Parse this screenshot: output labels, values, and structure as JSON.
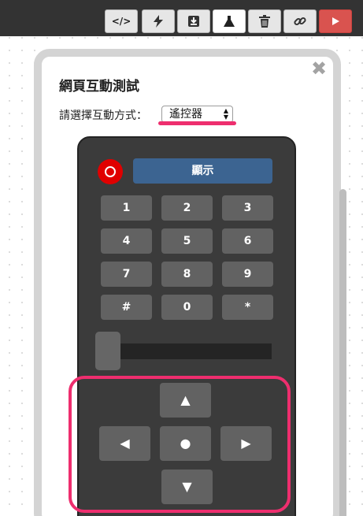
{
  "toolbar": {
    "buttons": [
      {
        "name": "code",
        "icon": "code-icon",
        "label": "</>"
      },
      {
        "name": "flash",
        "icon": "lightning-icon"
      },
      {
        "name": "download",
        "icon": "download-box-icon"
      },
      {
        "name": "test",
        "icon": "flask-icon",
        "active": true
      },
      {
        "name": "delete",
        "icon": "trash-icon"
      },
      {
        "name": "link",
        "icon": "link-icon"
      },
      {
        "name": "run",
        "icon": "play-icon"
      }
    ],
    "run_color": "#d9534f"
  },
  "panel": {
    "title": "網頁互動測試",
    "close_label": "✖",
    "mode_label": "請選擇互動方式：",
    "mode_value": "遙控器",
    "highlight_color": "#ee2e6e"
  },
  "remote": {
    "display_label": "顯示",
    "display_color": "#3c6491",
    "power_color": "#e00000",
    "keys": [
      [
        "1",
        "2",
        "3"
      ],
      [
        "4",
        "5",
        "6"
      ],
      [
        "7",
        "8",
        "9"
      ],
      [
        "#",
        "0",
        "*"
      ]
    ],
    "dpad": {
      "up": "▲",
      "left": "◀",
      "center": "●",
      "right": "▶",
      "down": "▼"
    }
  }
}
